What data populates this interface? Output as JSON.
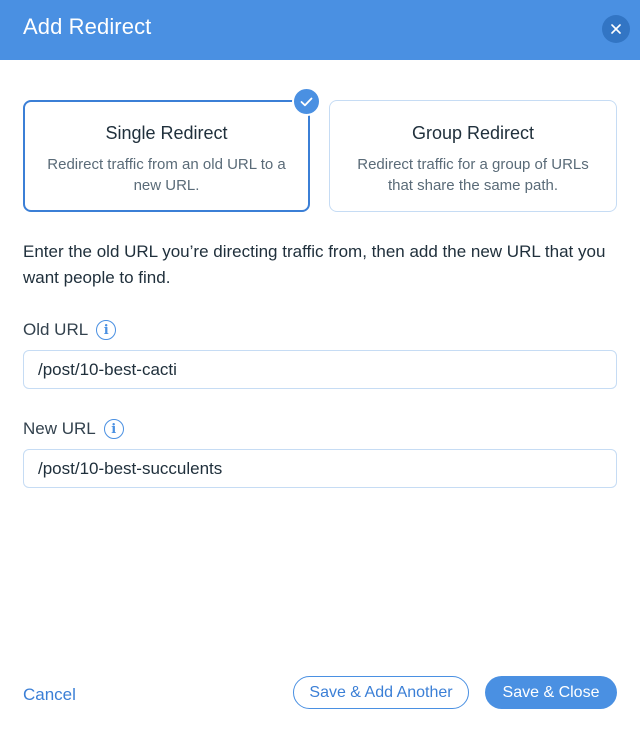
{
  "header": {
    "title": "Add Redirect",
    "close_icon": "close-icon"
  },
  "options": [
    {
      "title": "Single Redirect",
      "description": "Redirect traffic from an old URL to a new URL.",
      "selected": true
    },
    {
      "title": "Group Redirect",
      "description": "Redirect traffic for a group of URLs that share the same path.",
      "selected": false
    }
  ],
  "instructions": "Enter the old URL you’re directing traffic from, then add the new URL that you want people to find.",
  "old_url": {
    "label": "Old URL",
    "value": "/post/10-best-cacti"
  },
  "new_url": {
    "label": "New URL",
    "value": "/post/10-best-succulents"
  },
  "footer": {
    "cancel_label": "Cancel",
    "save_add_label": "Save & Add Another",
    "save_close_label": "Save & Close"
  },
  "colors": {
    "accent": "#4a90e2",
    "header_bg": "#4a90e2",
    "selected_border": "#3b7fd6",
    "input_border": "#c6dcf4"
  }
}
